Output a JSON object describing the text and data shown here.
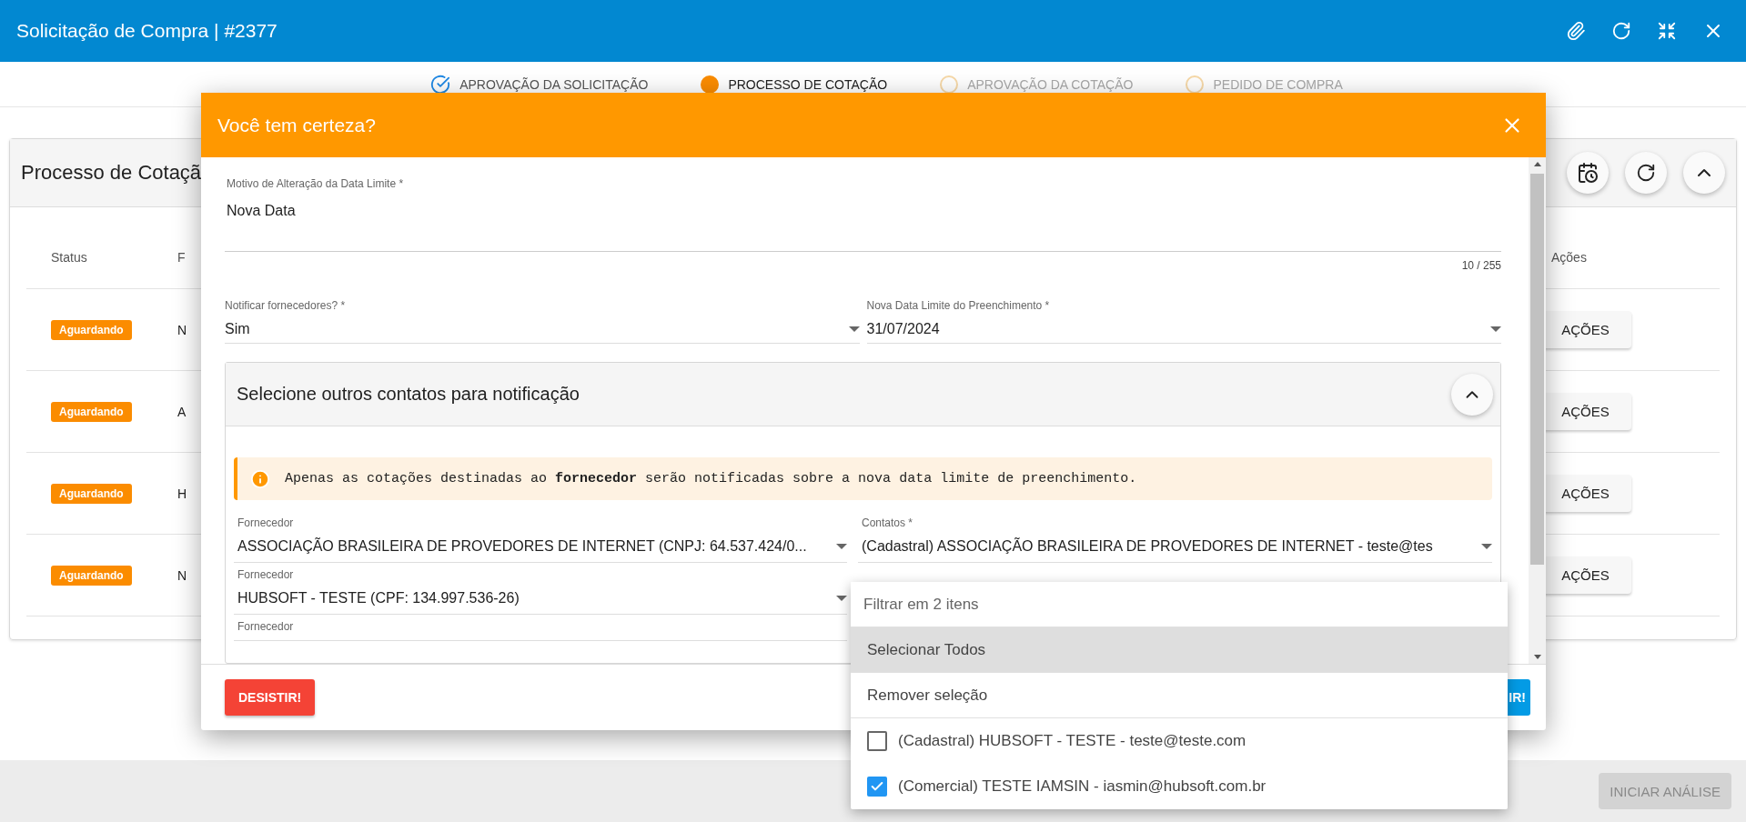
{
  "window": {
    "title": "Solicitação de Compra | #2377"
  },
  "steps": [
    {
      "label": "APROVAÇÃO DA SOLICITAÇÃO",
      "done": true,
      "selected": false
    },
    {
      "label": "PROCESSO DE COTAÇÃO",
      "done": false,
      "selected": true
    },
    {
      "label": "APROVAÇÃO DA COTAÇÃO",
      "done": false,
      "selected": false
    },
    {
      "label": "PEDIDO DE COMPRA",
      "done": false,
      "selected": false
    }
  ],
  "card": {
    "title": "Processo de Cotaçã",
    "columns": [
      "Status",
      "F",
      "Ações"
    ],
    "rows": [
      {
        "status": "Aguardando",
        "column_2": "N",
        "action": "AÇÕES"
      },
      {
        "status": "Aguardando",
        "column_2": "A",
        "action": "AÇÕES"
      },
      {
        "status": "Aguardando",
        "column_2": "H",
        "action": "AÇÕES"
      },
      {
        "status": "Aguardando",
        "column_2": "N",
        "action": "AÇÕES"
      }
    ]
  },
  "footer": {
    "button": "INICIAR ANÁLISE",
    "disabled": true
  },
  "dialog": {
    "title": "Você tem certeza?",
    "reason": {
      "label": "Motivo de Alteração da Data Limite *",
      "value": "Nova Data",
      "counter": "10 / 255"
    },
    "notify": {
      "label": "Notificar fornecedores? *",
      "value": "Sim"
    },
    "deadline": {
      "label": "Nova Data Limite do Preenchimento *",
      "value": "31/07/2024"
    },
    "panel": {
      "title": "Selecione outros contatos para notificação",
      "expanded": true,
      "alert": "Apenas as cotações destinadas ao **fornecedor** serão notificadas sobre a nova data limite de preenchimento.",
      "suppliers": [
        {
          "label": "Fornecedor",
          "value": "ASSOCIAÇÃO BRASILEIRA DE PROVEDORES DE INTERNET (CNPJ: 64.537.424/0...",
          "contacts": {
            "label": "Contatos *",
            "value": "(Cadastral) ASSOCIAÇÃO BRASILEIRA DE PROVEDORES DE INTERNET - teste@tes"
          }
        },
        {
          "label": "Fornecedor",
          "value": "HUBSOFT - TESTE (CPF: 134.997.536-26)"
        },
        {
          "label": "Fornecedor"
        }
      ]
    },
    "cancel": "DESISTIR!",
    "confirm": "IR!"
  },
  "dropdown": {
    "placeholder": "Filtrar em 2 itens",
    "actions": [
      {
        "label": "Selecionar Todos",
        "selected": true
      },
      {
        "label": "Remover seleção",
        "selected": false
      }
    ],
    "options": [
      {
        "label": "(Cadastral) HUBSOFT - TESTE - teste@teste.com",
        "checked": false
      },
      {
        "label": "(Comercial) TESTE IAMSIN - iasmin@hubsoft.com.br",
        "checked": true
      }
    ]
  }
}
